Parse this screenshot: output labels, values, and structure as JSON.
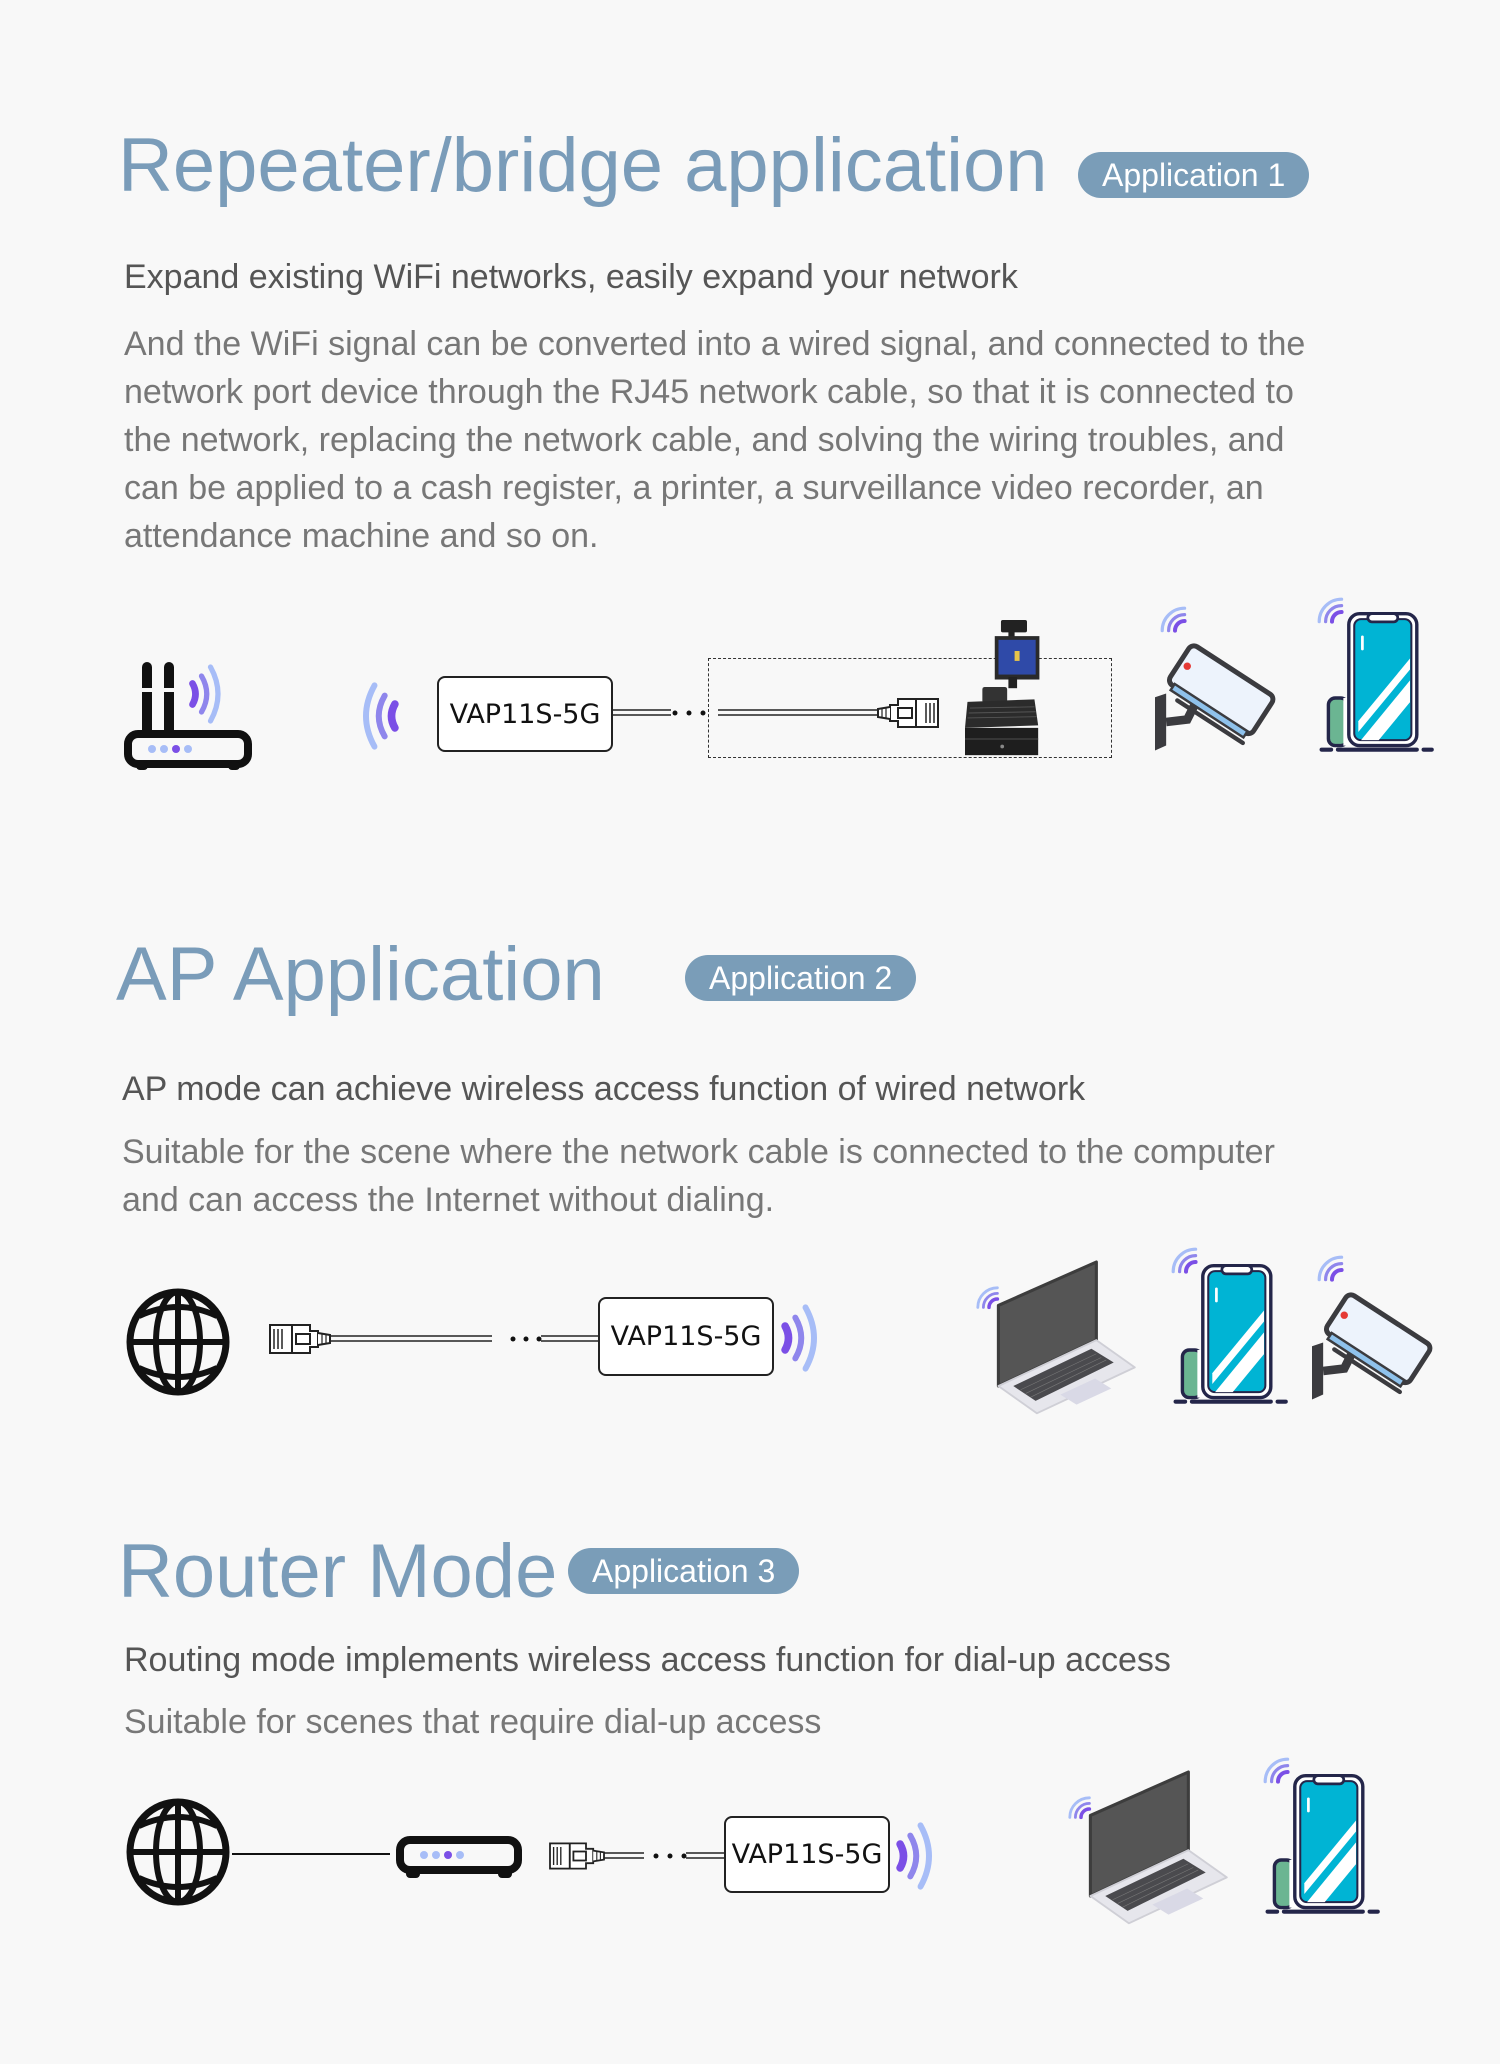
{
  "sections": [
    {
      "title": "Repeater/bridge application",
      "badge": "Application 1",
      "subtitle": "Expand existing WiFi networks,  easily expand your network",
      "paragraph_lines": [
        "And the WiFi signal can be converted into a wired signal, and connected to the",
        "network port device through the RJ45 network cable, so that it is connected to",
        "the network, replacing the network cable, and solving the wiring troubles, and",
        "can be applied to a cash register, a printer, a surveillance video recorder, an",
        "attendance machine and so on."
      ],
      "diagram": {
        "device_label": "VAP11S-5G",
        "nodes": [
          "router-icon",
          "wifi-signal-icon",
          "vap-device",
          "ethernet-cable",
          "rj45-plug-icon",
          "cash-register-icon",
          "security-camera-icon",
          "smartphone-icon"
        ]
      }
    },
    {
      "title": "AP Application",
      "badge": "Application 2",
      "subtitle": "AP mode can achieve wireless access function of wired network",
      "paragraph_lines": [
        "Suitable for the scene where the network cable is connected to the computer",
        "and can access the Internet without dialing."
      ],
      "diagram": {
        "device_label": "VAP11S-5G",
        "nodes": [
          "globe-icon",
          "rj45-plug-icon",
          "ethernet-cable",
          "vap-device",
          "wifi-signal-icon",
          "laptop-icon",
          "smartphone-icon",
          "security-camera-icon"
        ]
      }
    },
    {
      "title": "Router Mode",
      "badge": "Application 3",
      "subtitle": "Routing mode implements wireless access function for dial-up access",
      "paragraph_lines": [
        "Suitable for scenes that require dial-up access"
      ],
      "diagram": {
        "device_label": "VAP11S-5G",
        "nodes": [
          "globe-icon",
          "modem-icon",
          "rj45-plug-icon",
          "ethernet-cable",
          "vap-device",
          "wifi-signal-icon",
          "laptop-icon",
          "smartphone-icon"
        ]
      }
    }
  ],
  "colors": {
    "title": "#7a9cb9",
    "badge_bg": "#7a9db8",
    "subtitle": "#555555",
    "body": "#777777",
    "wifi_light": "#a7bdf7",
    "wifi_mid": "#8f86ec",
    "wifi_dark": "#7b4fe6",
    "phone_screen": "#00b4d4",
    "book_green": "#6bb592"
  }
}
